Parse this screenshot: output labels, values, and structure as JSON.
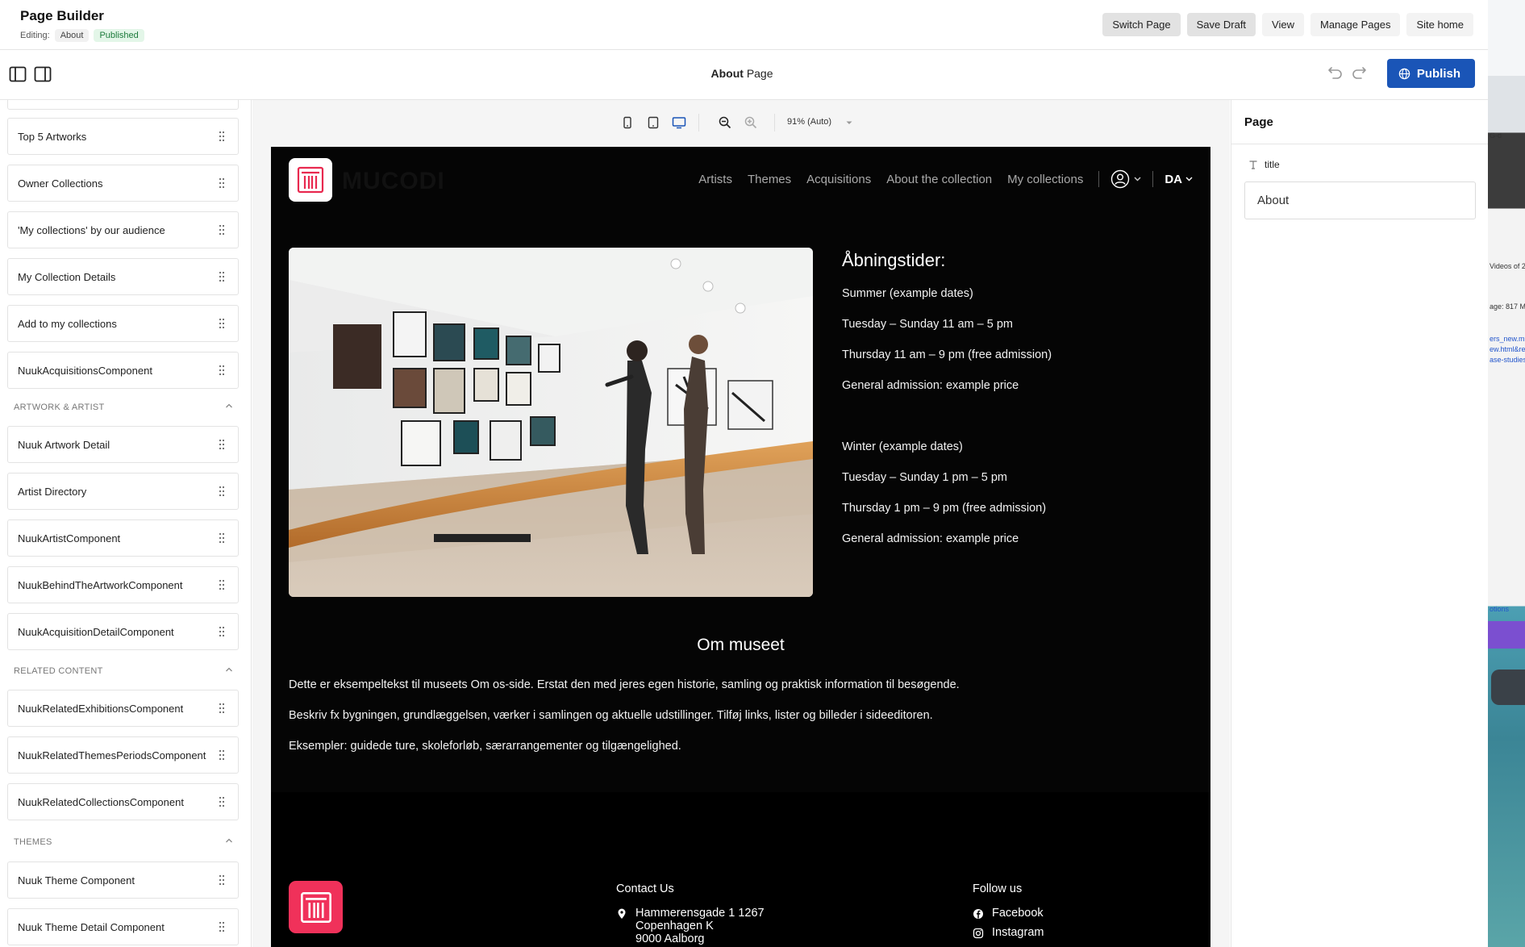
{
  "app": {
    "title": "Page Builder",
    "editing_label": "Editing:",
    "page_name": "About",
    "status": "Published"
  },
  "top_actions": [
    "Switch Page",
    "Save Draft",
    "View",
    "Manage Pages",
    "Site home"
  ],
  "subbar": {
    "page_title": "About",
    "page_suffix": "Page",
    "publish_label": "Publish"
  },
  "sidebar": {
    "items_group1": [
      "Top 5 Artworks",
      "Owner Collections",
      "'My collections' by our audience",
      "My Collection Details",
      "Add to my collections",
      "NuukAcquisitionsComponent"
    ],
    "section_artwork": "ARTWORK & ARTIST",
    "items_artwork": [
      "Nuuk Artwork Detail",
      "Artist Directory",
      "NuukArtistComponent",
      "NuukBehindTheArtworkComponent",
      "NuukAcquisitionDetailComponent"
    ],
    "section_related": "RELATED CONTENT",
    "items_related": [
      "NuukRelatedExhibitionsComponent",
      "NuukRelatedThemesPeriodsComponent",
      "NuukRelatedCollectionsComponent"
    ],
    "section_themes": "THEMES",
    "items_themes": [
      "Nuuk Theme Component",
      "Nuuk Theme Detail Component"
    ]
  },
  "canvas": {
    "zoom_label": "91% (Auto)"
  },
  "site": {
    "brand": "MUCODI",
    "nav": [
      "Artists",
      "Themes",
      "Acquisitions",
      "About the collection",
      "My collections"
    ],
    "language": "DA",
    "hours_title": "Åbningstider:",
    "summer": [
      "Summer (example dates)",
      "Tuesday – Sunday 11 am – 5 pm",
      "Thursday 11 am – 9 pm (free admission)",
      "General admission: example price"
    ],
    "winter": [
      "Winter (example dates)",
      "Tuesday – Sunday 1 pm – 5 pm",
      "Thursday 1 pm – 9 pm (free admission)",
      "General admission: example price"
    ],
    "about_title": "Om museet",
    "about_paragraphs": [
      "Dette er eksempeltekst til museets Om os-side. Erstat den med jeres egen historie, samling og praktisk information til besøgende.",
      "Beskriv fx bygningen, grundlæggelsen, værker i samlingen og aktuelle udstillinger. Tilføj links, lister og billeder i sideeditoren.",
      "Eksempler: guidede ture, skoleforløb, særarrangementer og tilgængelighed."
    ],
    "footer": {
      "contact_heading": "Contact Us",
      "address": [
        "Hammerensgade 1 1267",
        "Copenhagen K",
        "9000 Aalborg"
      ],
      "follow_heading": "Follow us",
      "social": [
        "Facebook",
        "Instagram"
      ]
    }
  },
  "right_panel": {
    "title": "Page",
    "field_label": "title",
    "field_value": "About"
  },
  "colors": {
    "accent": "#1a55b7",
    "brand_red": "#f0315a",
    "published_bg": "#e3f6e8",
    "published_text": "#1b7a3a"
  }
}
